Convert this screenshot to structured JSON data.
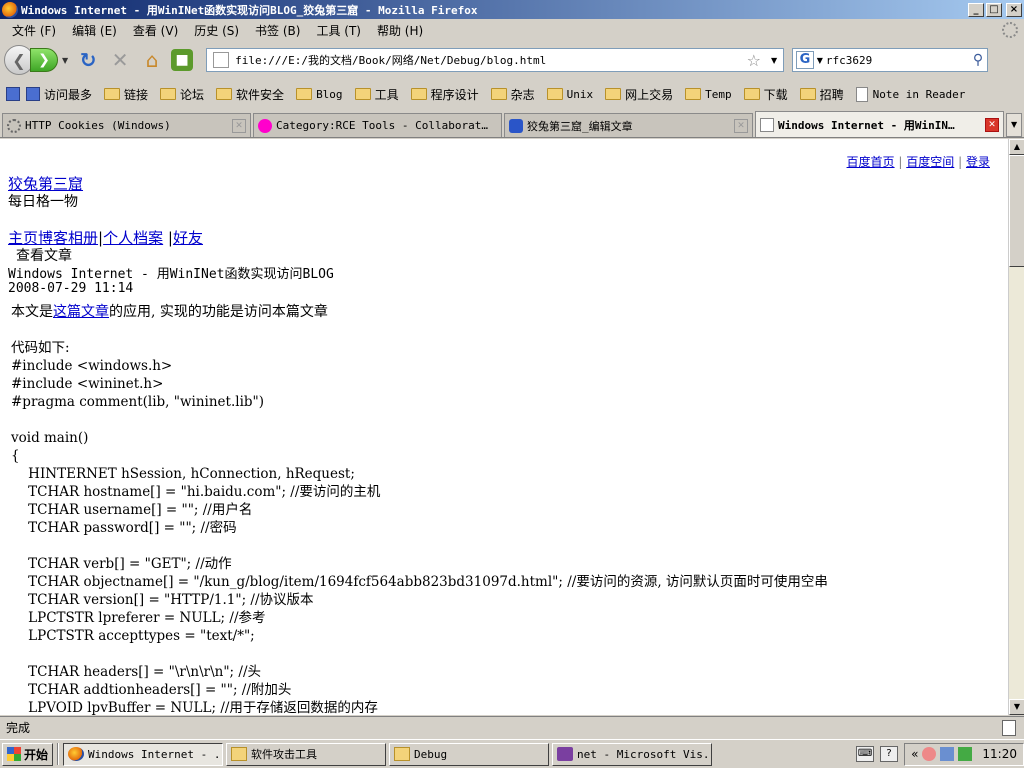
{
  "window": {
    "title": "Windows Internet - 用WinINet函数实现访问BLOG_狡兔第三窟 - Mozilla Firefox",
    "buttons": [
      "_",
      "□",
      "×"
    ]
  },
  "menu": [
    "文件 (F)",
    "编辑 (E)",
    "查看 (V)",
    "历史 (S)",
    "书签 (B)",
    "工具 (T)",
    "帮助 (H)"
  ],
  "nav": {
    "url": "file:///E:/我的文档/Book/网络/Net/Debug/blog.html",
    "search_value": "rfc3629"
  },
  "bookmarks": [
    {
      "label": "访问最多",
      "icon": "blue"
    },
    {
      "label": "链接",
      "icon": "folder"
    },
    {
      "label": "论坛",
      "icon": "folder"
    },
    {
      "label": "软件安全",
      "icon": "folder"
    },
    {
      "label": "Blog",
      "icon": "folder"
    },
    {
      "label": "工具",
      "icon": "folder"
    },
    {
      "label": "程序设计",
      "icon": "folder"
    },
    {
      "label": "杂志",
      "icon": "folder"
    },
    {
      "label": "Unix",
      "icon": "folder"
    },
    {
      "label": "网上交易",
      "icon": "folder"
    },
    {
      "label": "Temp",
      "icon": "folder"
    },
    {
      "label": "下载",
      "icon": "folder"
    },
    {
      "label": "招聘",
      "icon": "folder"
    },
    {
      "label": "Note in Reader",
      "icon": "page"
    }
  ],
  "tabs": [
    {
      "label": "HTTP Cookies (Windows)",
      "icon": "gear",
      "active": false
    },
    {
      "label": "Category:RCE Tools - Collaborat…",
      "icon": "wiki",
      "active": false
    },
    {
      "label": "狡兔第三窟_编辑文章",
      "icon": "baidu",
      "active": false
    },
    {
      "label": "Windows Internet - 用WinIN…",
      "icon": "page",
      "active": true
    }
  ],
  "page": {
    "top_links": [
      "百度首页",
      "百度空间",
      "登录"
    ],
    "top_sep": "|",
    "blog_title": "狡兔第三窟",
    "blog_subtitle": "每日格一物",
    "nav_links": [
      "主页",
      "博客",
      "相册",
      "个人档案",
      "好友"
    ],
    "nav_sep": "|",
    "view_label": "查看文章",
    "article_title": "Windows Internet - 用WinINet函数实现访问BLOG",
    "article_date": "2008-07-29 11:14",
    "intro_before": "本文是",
    "intro_link": "这篇文章",
    "intro_after": "的应用, 实现的功能是访问本篇文章",
    "code": "代码如下:\n#include <windows.h>\n#include <wininet.h>\n#pragma comment(lib, \"wininet.lib\")\n\nvoid main()\n{\n    HINTERNET hSession, hConnection, hRequest;\n    TCHAR hostname[] = \"hi.baidu.com\"; //要访问的主机\n    TCHAR username[] = \"\"; //用户名\n    TCHAR password[] = \"\"; //密码\n\n    TCHAR verb[] = \"GET\"; //动作\n    TCHAR objectname[] = \"/kun_g/blog/item/1694fcf564abb823bd31097d.html\"; //要访问的资源, 访问默认页面时可使用空串\n    TCHAR version[] = \"HTTP/1.1\"; //协议版本\n    LPCTSTR lpreferer = NULL; //参考\n    LPCTSTR accepttypes = \"text/*\";\n\n    TCHAR headers[] = \"\\r\\n\\r\\n\"; //头\n    TCHAR addtionheaders[] = \"\"; //附加头\n    LPVOID lpvBuffer = NULL; //用于存储返回数据的内存"
  },
  "status": {
    "text": "完成"
  },
  "taskbar": {
    "start": "开始",
    "tasks": [
      {
        "label": "Windows Internet - ...",
        "icon": "ff",
        "active": true
      },
      {
        "label": "软件攻击工具",
        "icon": "folder",
        "active": false
      },
      {
        "label": "Debug",
        "icon": "folder",
        "active": false
      },
      {
        "label": "net - Microsoft Vis...",
        "icon": "vs",
        "active": false
      }
    ],
    "clock": "11:20"
  }
}
